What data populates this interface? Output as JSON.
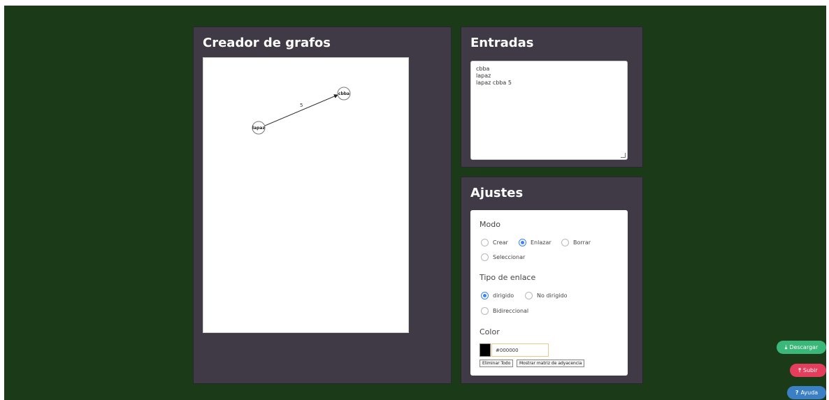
{
  "graph_panel": {
    "title": "Creador de grafos",
    "nodes": [
      {
        "id": "cbba",
        "label": "cbba"
      },
      {
        "id": "lapaz",
        "label": "lapaz"
      }
    ],
    "edges": [
      {
        "from": "lapaz",
        "to": "cbba",
        "weight": "5",
        "directed": true
      }
    ]
  },
  "inputs_panel": {
    "title": "Entradas",
    "text": "cbba\nlapaz\nlapaz cbba 5"
  },
  "settings_panel": {
    "title": "Ajustes",
    "mode": {
      "label": "Modo",
      "options": [
        "Crear",
        "Enlazar",
        "Borrar",
        "Seleccionar"
      ],
      "selected": "Enlazar"
    },
    "link_type": {
      "label": "Tipo de enlace",
      "options": [
        "dirigido",
        "No dirigido",
        "Bidireccional"
      ],
      "selected": "dirigido"
    },
    "color": {
      "label": "Color",
      "value": "#000000"
    },
    "buttons": {
      "clear_all": "Eliminar Todo",
      "show_matrix": "Mostrar matriz de adyacencia"
    }
  },
  "floating_actions": {
    "download": {
      "label": "Descargar",
      "icon": "download-icon",
      "color": "#3bb779"
    },
    "upload": {
      "label": "Subir",
      "icon": "upload-icon",
      "color": "#e53e5d"
    },
    "help": {
      "label": "Ayuda",
      "icon": "help-icon",
      "color": "#3b7fc4"
    }
  },
  "colors": {
    "background": "#1b3a18",
    "panel": "#3f3a45",
    "accent": "#3b82f6"
  }
}
